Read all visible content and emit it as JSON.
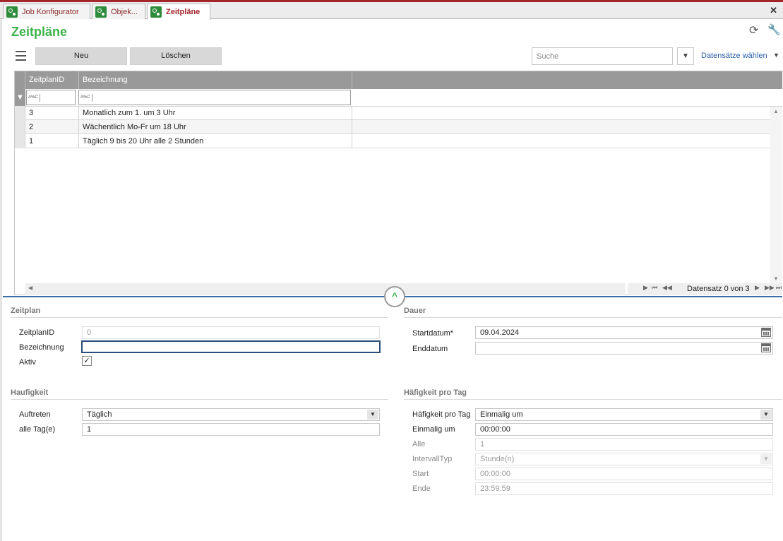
{
  "tabs": [
    {
      "label": "Job Konfigurator",
      "active": false
    },
    {
      "label": "Objek...",
      "active": false
    },
    {
      "label": "Zeitpläne",
      "active": true
    }
  ],
  "close_symbol": "✕",
  "page_title": "Zeitpläne",
  "toolbar": {
    "new_label": "Neu",
    "delete_label": "Löschen",
    "search_placeholder": "Suche",
    "records_select_label": "Datensätze wählen"
  },
  "grid": {
    "columns": [
      "ZeitplanID",
      "Bezeichnung"
    ],
    "rows": [
      {
        "id": "3",
        "name": "Monatlich zum 1. um 3 Uhr"
      },
      {
        "id": "2",
        "name": "Wächentlich Mo-Fr um 18 Uhr"
      },
      {
        "id": "1",
        "name": "Täglich 9 bis 20 Uhr alle 2 Stunden"
      }
    ],
    "filter_hint": "A%C",
    "pager_text": "Datensatz 0 von 3"
  },
  "zeitplan": {
    "title": "Zeitplan",
    "id_label": "ZeitplanID",
    "id_value": "0",
    "name_label": "Bezeichnung",
    "name_value": "",
    "active_label": "Aktiv",
    "active_checked": true
  },
  "dauer": {
    "title": "Dauer",
    "start_label": "Startdatum*",
    "start_value": "09.04.2024",
    "end_label": "Enddatum",
    "end_value": ""
  },
  "haufigkeit": {
    "title": "Haufigkeit",
    "occur_label": "Auftreten",
    "occur_value": "Täglich",
    "every_label": "alle Tag(e)",
    "every_value": "1"
  },
  "pro_tag": {
    "title": "Häfigkeit pro Tag",
    "freq_label": "Häfigkeit pro Tag",
    "freq_value": "Einmalig um",
    "once_label": "Einmalig um",
    "once_value": "00:00:00",
    "all_label": "Alle",
    "all_value": "1",
    "interval_label": "IntervallTyp",
    "interval_value": "Stunde(n)",
    "start_label": "Start",
    "start_value": "00:00:00",
    "end_label": "Ende",
    "end_value": "23:59:59"
  },
  "colors": {
    "accent_green": "#3cb34a",
    "brand_red": "#a4262c",
    "link_blue": "#2a5fa8"
  },
  "icons": [
    "hamburger-menu-icon",
    "refresh-icon",
    "wrench-icon",
    "close-icon",
    "calendar-icon",
    "filter-funnel-icon",
    "collapse-chevron-icon"
  ]
}
